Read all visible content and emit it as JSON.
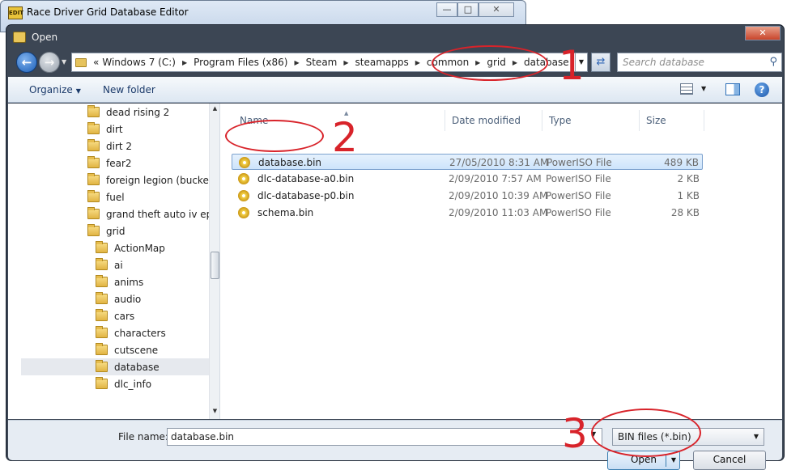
{
  "background_window": {
    "title": "Race Driver Grid Database Editor",
    "icon_text": "EDIT"
  },
  "dialog": {
    "title": "Open"
  },
  "address": {
    "path": [
      "Windows 7 (C:)",
      "Program Files (x86)",
      "Steam",
      "steamapps",
      "common",
      "grid",
      "database"
    ],
    "overflow_glyph": "«",
    "search_placeholder": "Search database"
  },
  "toolbar": {
    "organize": "Organize",
    "new_folder": "New folder"
  },
  "nav_tree": [
    {
      "label": "dead rising 2",
      "level": 1
    },
    {
      "label": "dirt",
      "level": 1
    },
    {
      "label": "dirt 2",
      "level": 1
    },
    {
      "label": "fear2",
      "level": 1
    },
    {
      "label": "foreign legion (buckets",
      "level": 1
    },
    {
      "label": "fuel",
      "level": 1
    },
    {
      "label": "grand theft auto iv epis",
      "level": 1
    },
    {
      "label": "grid",
      "level": 1
    },
    {
      "label": "ActionMap",
      "level": 2
    },
    {
      "label": "ai",
      "level": 2
    },
    {
      "label": "anims",
      "level": 2
    },
    {
      "label": "audio",
      "level": 2
    },
    {
      "label": "cars",
      "level": 2
    },
    {
      "label": "characters",
      "level": 2
    },
    {
      "label": "cutscene",
      "level": 2
    },
    {
      "label": "database",
      "level": 2,
      "selected": true
    },
    {
      "label": "dlc_info",
      "level": 2
    }
  ],
  "columns": {
    "name": "Name",
    "date": "Date modified",
    "type": "Type",
    "size": "Size"
  },
  "files": [
    {
      "name": "database.bin",
      "date": "27/05/2010 8:31 AM",
      "type": "PowerISO File",
      "size": "489 KB",
      "selected": true
    },
    {
      "name": "dlc-database-a0.bin",
      "date": "2/09/2010 7:57 AM",
      "type": "PowerISO File",
      "size": "2 KB"
    },
    {
      "name": "dlc-database-p0.bin",
      "date": "2/09/2010 10:39 AM",
      "type": "PowerISO File",
      "size": "1 KB"
    },
    {
      "name": "schema.bin",
      "date": "2/09/2010 11:03 AM",
      "type": "PowerISO File",
      "size": "28 KB"
    }
  ],
  "bottom": {
    "file_name_label": "File name:",
    "file_name_value": "database.bin",
    "filter": "BIN files (*.bin)",
    "open": "Open",
    "cancel": "Cancel"
  },
  "annotations": {
    "step1": "1",
    "step2": "2",
    "step3": "3",
    "color": "#d8232a"
  }
}
